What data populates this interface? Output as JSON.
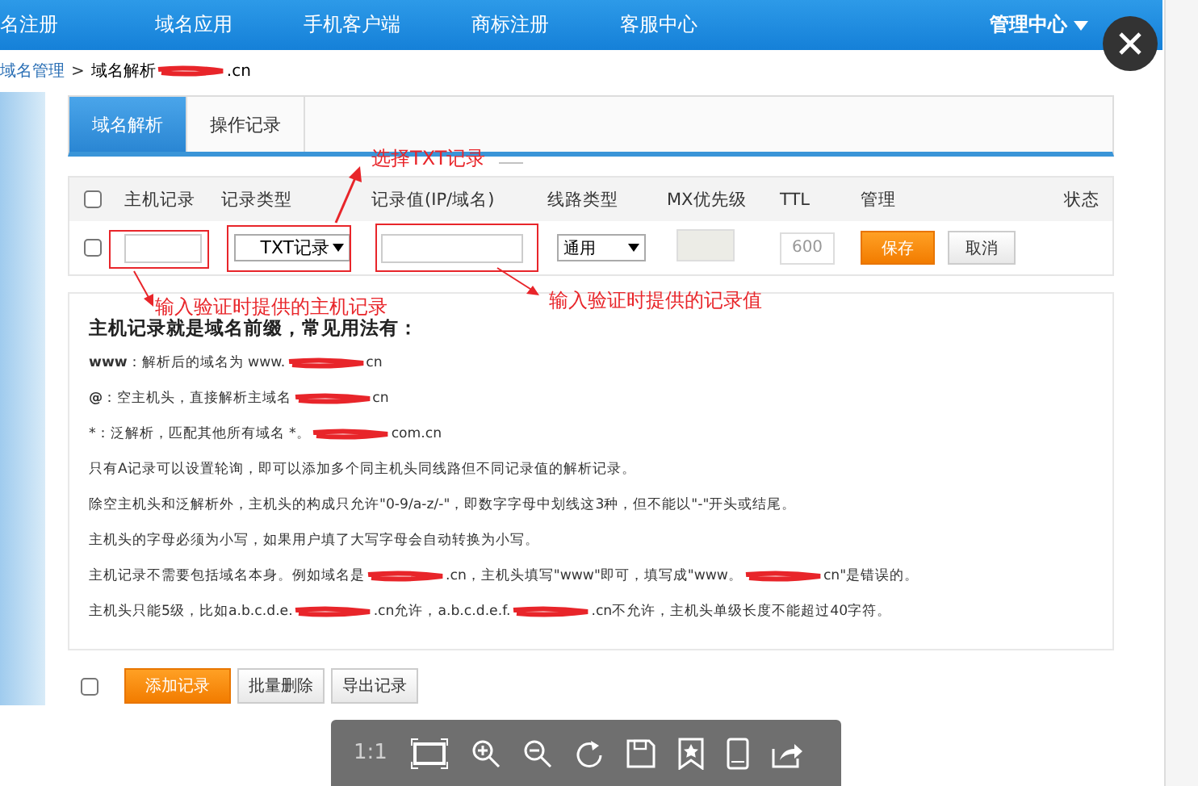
{
  "nav": {
    "items": [
      "名注册",
      "域名应用",
      "手机客户端",
      "商标注册",
      "客服中心"
    ],
    "admin": "管理中心"
  },
  "breadcrumb": {
    "link": "域名管理",
    "separator": ">",
    "current": [
      "域名解析",
      ".cn"
    ]
  },
  "tabs": [
    {
      "label": "域名解析",
      "selected": true
    },
    {
      "label": "操作记录",
      "selected": false
    }
  ],
  "table": {
    "header_checked": false,
    "columns": [
      "主机记录",
      "记录类型",
      "记录值(IP/域名)",
      "线路类型",
      "MX优先级",
      "TTL",
      "管理",
      "状态"
    ],
    "row": {
      "checked": false,
      "type": "TXT记录",
      "line": "通用",
      "ttl": "600",
      "save": "保存",
      "cancel": "取消"
    }
  },
  "annotations": {
    "select_type": "选择TXT记录",
    "host": "输入验证时提供的主机记录",
    "value": "输入验证时提供的记录值"
  },
  "help": {
    "title": "主机记录就是域名前缀，常见用法有：",
    "lines": [
      {
        "parts": [
          "**www**：解析后的域名为 www.",
          "cn"
        ]
      },
      {
        "parts": [
          "**@**：空主机头，直接解析主域名",
          "cn"
        ]
      },
      {
        "parts": [
          "*：泛解析，匹配其他所有域名 *。",
          "com.cn"
        ]
      },
      {
        "parts": [
          "只有A记录可以设置轮询，即可以添加多个同主机头同线路但不同记录值的解析记录。"
        ]
      },
      {
        "parts": [
          "除空主机头和泛解析外，主机头的构成只允许\"0-9/a-z/-\"，即数字字母中划线这3种，但不能以\"-\"开头或结尾。"
        ]
      },
      {
        "parts": [
          "主机头的字母必须为小写，如果用户填了大写字母会自动转换为小写。"
        ]
      },
      {
        "parts": [
          "主机记录不需要包括域名本身。例如域名是",
          ".cn，主机头填写\"www\"即可，填写成\"www。",
          "cn\"是错误的。"
        ]
      },
      {
        "parts": [
          "主机头只能5级，比如a.b.c.d.e.",
          ".cn允许，a.b.c.d.e.f.",
          ".cn不允许，主机头单级长度不能超过40字符。"
        ]
      }
    ]
  },
  "bottom": {
    "checked": false,
    "buttons": [
      {
        "label": "添加记录",
        "kind": "primary"
      },
      {
        "label": "批量删除",
        "kind": "default"
      },
      {
        "label": "导出记录",
        "kind": "default"
      }
    ]
  },
  "viewer_toolbar": {
    "ratio": "1:1"
  }
}
